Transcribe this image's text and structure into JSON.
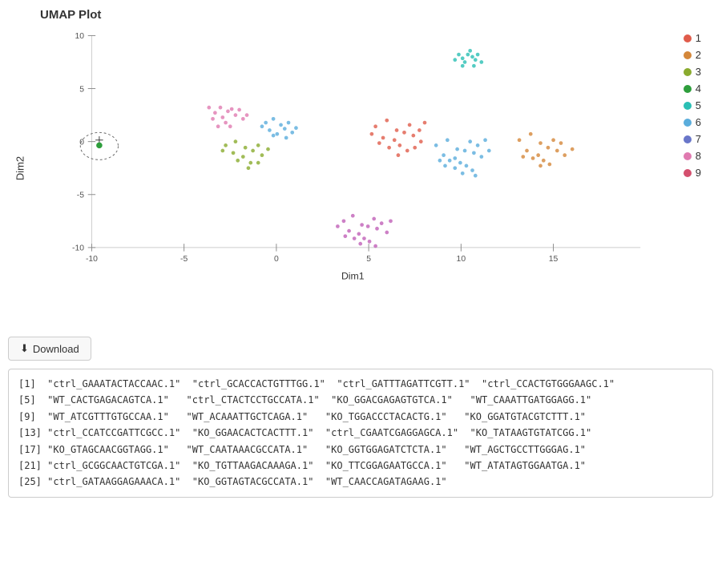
{
  "title": "UMAP Plot",
  "axes": {
    "dim1": "Dim1",
    "dim2": "Dim2",
    "x_ticks": [
      "-10",
      "-5",
      "0",
      "5",
      "10",
      "15"
    ],
    "y_ticks": [
      "10",
      "5",
      "0",
      "-5",
      "-10"
    ]
  },
  "legend": {
    "items": [
      {
        "label": "1",
        "color": "#e05c4b"
      },
      {
        "label": "2",
        "color": "#d4873a"
      },
      {
        "label": "3",
        "color": "#8aab2e"
      },
      {
        "label": "4",
        "color": "#2e9e3c"
      },
      {
        "label": "5",
        "color": "#2abfb4"
      },
      {
        "label": "6",
        "color": "#5aaddc"
      },
      {
        "label": "7",
        "color": "#6976c9"
      },
      {
        "label": "8",
        "color": "#e07ab0"
      },
      {
        "label": "9",
        "color": "#d44f6e"
      }
    ]
  },
  "download_button": {
    "label": "Download",
    "icon": "⬇"
  },
  "output_lines": [
    "[1]  \"ctrl_GAAATACTACCAAC.1\"  \"ctrl_GCACCACTGTTTGG.1\"  \"ctrl_GATTTAGATTCGTT.1\"  \"ctrl_CCACTGTGGGAAGC.1\"",
    "[5]  \"WT_CACTGAGACAGTCA.1\"   \"ctrl_CTACTCCTGCCATA.1\"  \"KO_GGACGAGAGTGTCA.1\"   \"WT_CAAATTGATGGAGG.1\"",
    "[9]  \"WT_ATCGTTTGTGCCAA.1\"   \"WT_ACAAATTGCTCAGA.1\"   \"KO_TGGACCCTACACTG.1\"   \"KO_GGATGTACGTCTTT.1\"",
    "[13] \"ctrl_CCATCCGATTCGCC.1\"  \"KO_GGAACACTCACTTT.1\"  \"ctrl_CGAATCGAGGAGCA.1\"  \"KO_TATAAGTGTATCGG.1\"",
    "[17] \"KO_GTAGCAACGGTAGG.1\"   \"WT_CAATAAACGCCATA.1\"   \"KO_GGTGGAGATCTCTA.1\"   \"WT_AGCTGCCTTGGGAG.1\"",
    "[21] \"ctrl_GCGGCAACTGTCGA.1\"  \"KO_TGTTAAGACAAAGA.1\"  \"KO_TTCGGAGAATGCCA.1\"   \"WT_ATATAGTGGAATGA.1\"",
    "[25] \"ctrl_GATAAGGAGAAACA.1\"  \"KO_GGTAGTACGCCATA.1\"  \"WT_CAACCAGATAGAAG.1\""
  ],
  "clusters": {
    "teal_top": {
      "cx": 645,
      "cy": 65,
      "color": "#2abfb4"
    },
    "pink_left": {
      "cx": 270,
      "cy": 145,
      "color": "#e07ab0"
    },
    "blue_left": {
      "cx": 330,
      "cy": 165,
      "color": "#5aaddc"
    },
    "olive_left": {
      "cx": 295,
      "cy": 185,
      "color": "#8aab2e"
    },
    "salmon_mid": {
      "cx": 560,
      "cy": 165,
      "color": "#e05c4b"
    },
    "cyan_mid": {
      "cx": 620,
      "cy": 185,
      "color": "#5aaddc"
    },
    "orange_right": {
      "cx": 720,
      "cy": 175,
      "color": "#d4873a"
    },
    "purple_bottom": {
      "cx": 490,
      "cy": 305,
      "color": "#e07ab0"
    },
    "green_small": {
      "cx": 100,
      "cy": 215,
      "color": "#2e9e3c"
    }
  }
}
